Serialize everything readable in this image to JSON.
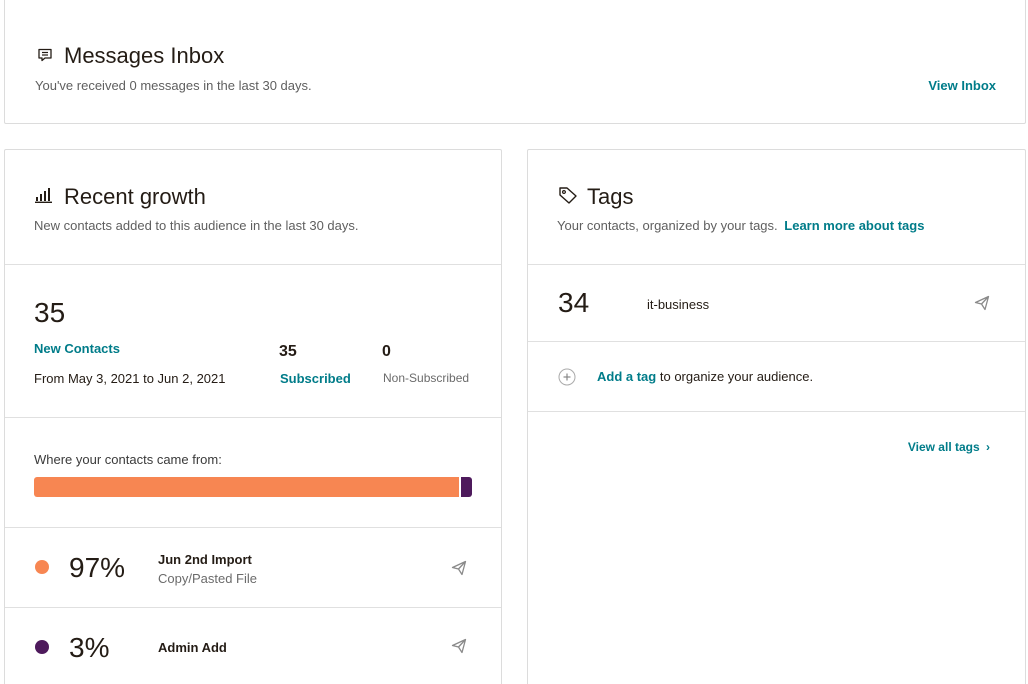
{
  "inbox": {
    "title": "Messages Inbox",
    "subtitle": "You've received 0 messages in the last 30 days.",
    "view_link": "View Inbox"
  },
  "growth": {
    "title": "Recent growth",
    "subtitle": "New contacts added to this audience in the last 30 days.",
    "total": "35",
    "new_contacts_label": "New Contacts",
    "date_range": "From May 3, 2021 to Jun 2, 2021",
    "subscribed_count": "35",
    "subscribed_label": "Subscribed",
    "non_subscribed_count": "0",
    "non_subscribed_label": "Non-Subscribed",
    "sources_label": "Where your contacts came from:",
    "source_bar": [
      {
        "fraction": 0.97,
        "color": "#f78652"
      },
      {
        "fraction": 0.03,
        "color": "#4e1a5c"
      }
    ],
    "sources": [
      {
        "color": "#f78652",
        "percent": "97%",
        "name": "Jun 2nd Import",
        "detail": "Copy/Pasted File"
      },
      {
        "color": "#4e1a5c",
        "percent": "3%",
        "name": "Admin Add",
        "detail": ""
      }
    ]
  },
  "tags": {
    "title": "Tags",
    "subtitle": "Your contacts, organized by your tags.",
    "learn_link": "Learn more about tags",
    "items": [
      {
        "count": "34",
        "name": "it-business"
      }
    ],
    "add_tag_link": "Add a tag",
    "add_tag_text": "to organize your audience.",
    "view_all": "View all tags"
  }
}
